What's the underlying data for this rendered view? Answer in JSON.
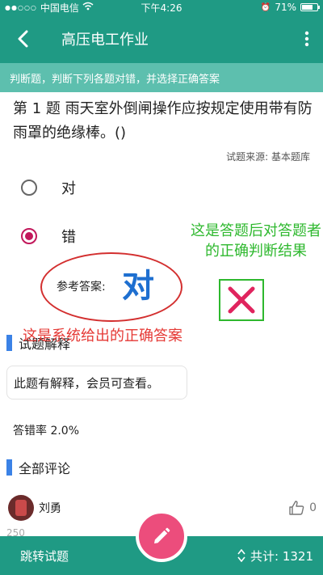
{
  "status_bar": {
    "carrier": "中国电信",
    "time": "下午4:26",
    "battery": "71%",
    "battery_level": 0.71
  },
  "header": {
    "title": "高压电工作业"
  },
  "instruction": "判断题，判断下列各题对错，并选择正确答案",
  "question": {
    "text": "第 1 题 雨天室外倒闸操作应按规定使用带有防雨罩的绝缘棒。()",
    "source": "试题来源: 基本题库",
    "options": [
      {
        "label": "对",
        "selected": false
      },
      {
        "label": "错",
        "selected": true
      }
    ]
  },
  "reference": {
    "label": "参考答案:",
    "answer": "对"
  },
  "annotations": {
    "green": "这是答题后对答题者的正确判断结果",
    "red": "这是系统给出的正确答案"
  },
  "explanation": {
    "title": "试题解释",
    "text": "此题有解释，会员可查看。"
  },
  "error_rate": "答错率 2.0%",
  "comments": {
    "title": "全部评论",
    "items": [
      {
        "user": "刘勇",
        "likes": "0",
        "snippet": "250"
      }
    ]
  },
  "bottom_bar": {
    "jump_label": "跳转试题",
    "total_label": "共计: 1321"
  },
  "icons": {
    "wifi": "wifi-icon",
    "back": "back-arrow-icon",
    "more": "more-vertical-icon",
    "wrong": "cross-icon",
    "like": "thumb-up-icon",
    "edit": "pencil-icon",
    "sort": "up-down-icon"
  },
  "colors": {
    "primary": "#1f9a84",
    "instruction_bg": "#5dbfae",
    "selected_radio": "#c2185b",
    "reference_answer": "#1e6fd0",
    "annotation_green": "#2eb82e",
    "annotation_red": "#e53935",
    "fab": "#ec4d7c",
    "section_marker": "#3b82e6"
  }
}
